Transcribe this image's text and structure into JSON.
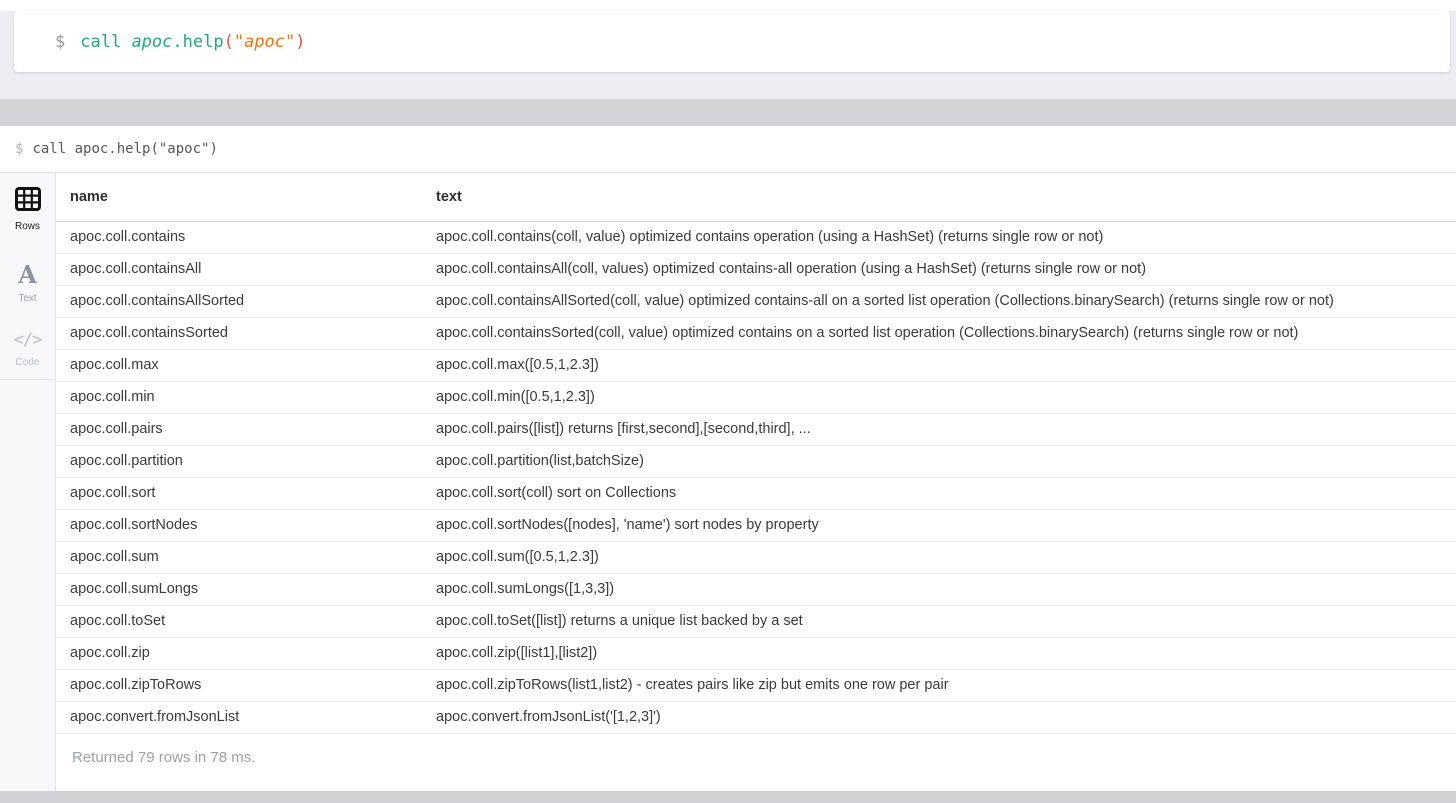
{
  "editor_bar": {
    "prompt": "$",
    "command_parts": [
      {
        "text": "call ",
        "type": "keyword"
      },
      {
        "text": "apoc",
        "type": "proc"
      },
      {
        "text": ".",
        "type": "keyword"
      },
      {
        "text": "help",
        "type": "keyword"
      },
      {
        "text": "(",
        "type": "paren"
      },
      {
        "text": "\"apoc\"",
        "type": "string"
      },
      {
        "text": ")",
        "type": "paren"
      }
    ]
  },
  "result_frame": {
    "header": {
      "prompt": "$",
      "command": "call apoc.help(\"apoc\")"
    },
    "view_sidebar": {
      "items": [
        {
          "label": "Rows",
          "icon": "table-grid-icon",
          "active": true
        },
        {
          "label": "Text",
          "icon": "letter-a-icon",
          "active": false
        },
        {
          "label": "Code",
          "icon": "code-brackets-icon",
          "active": false
        }
      ]
    },
    "table": {
      "columns": [
        "name",
        "text"
      ],
      "rows": [
        [
          "apoc.coll.contains",
          "apoc.coll.contains(coll, value) optimized contains operation (using a HashSet) (returns single row or not)"
        ],
        [
          "apoc.coll.containsAll",
          "apoc.coll.containsAll(coll, values) optimized contains-all operation (using a HashSet) (returns single row or not)"
        ],
        [
          "apoc.coll.containsAllSorted",
          "apoc.coll.containsAllSorted(coll, value) optimized contains-all on a sorted list operation (Collections.binarySearch) (returns single row or not)"
        ],
        [
          "apoc.coll.containsSorted",
          "apoc.coll.containsSorted(coll, value) optimized contains on a sorted list operation (Collections.binarySearch) (returns single row or not)"
        ],
        [
          "apoc.coll.max",
          "apoc.coll.max([0.5,1,2.3])"
        ],
        [
          "apoc.coll.min",
          "apoc.coll.min([0.5,1,2.3])"
        ],
        [
          "apoc.coll.pairs",
          "apoc.coll.pairs([list]) returns [first,second],[second,third], ..."
        ],
        [
          "apoc.coll.partition",
          "apoc.coll.partition(list,batchSize)"
        ],
        [
          "apoc.coll.sort",
          "apoc.coll.sort(coll) sort on Collections"
        ],
        [
          "apoc.coll.sortNodes",
          "apoc.coll.sortNodes([nodes], 'name') sort nodes by property"
        ],
        [
          "apoc.coll.sum",
          "apoc.coll.sum([0.5,1,2.3])"
        ],
        [
          "apoc.coll.sumLongs",
          "apoc.coll.sumLongs([1,3,3])"
        ],
        [
          "apoc.coll.toSet",
          "apoc.coll.toSet([list]) returns a unique list backed by a set"
        ],
        [
          "apoc.coll.zip",
          "apoc.coll.zip([list1],[list2])"
        ],
        [
          "apoc.coll.zipToRows",
          "apoc.coll.zipToRows(list1,list2) - creates pairs like zip but emits one row per pair"
        ],
        [
          "apoc.convert.fromJsonList",
          "apoc.convert.fromJsonList('[1,2,3]')"
        ]
      ]
    },
    "status": "Returned 79 rows in 78 ms."
  },
  "colors": {
    "keyword": "#23a77f",
    "paren": "#e4514c",
    "string": "#f2720c",
    "editor_bg": "#eeedf3",
    "divider": "#d2d4d8",
    "bottom_bar": "#cfd1d5"
  }
}
